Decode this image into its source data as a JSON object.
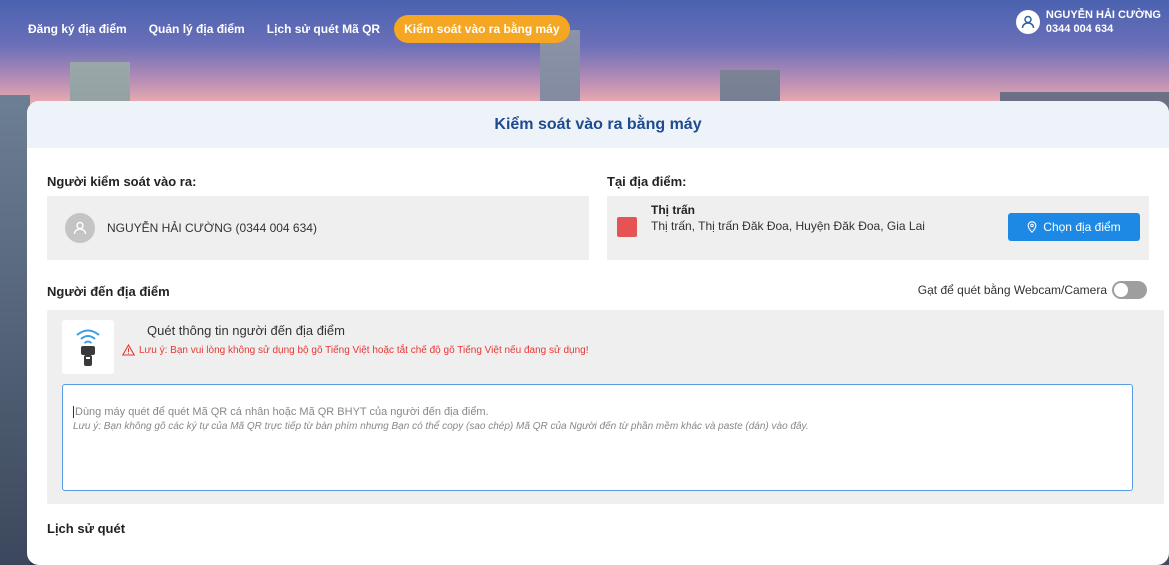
{
  "nav": {
    "items": [
      {
        "label": "Đăng ký địa điểm",
        "active": false
      },
      {
        "label": "Quản lý địa điểm",
        "active": false
      },
      {
        "label": "Lịch sử quét Mã QR",
        "active": false
      },
      {
        "label": "Kiểm soát vào ra bằng máy",
        "active": true
      }
    ]
  },
  "user": {
    "name": "NGUYỄN HẢI CƯỜNG",
    "phone": "0344 004 634",
    "icon": "user-icon"
  },
  "page": {
    "title": "Kiểm soát vào ra bằng máy"
  },
  "controller": {
    "label": "Người kiểm soát vào ra:",
    "name": "NGUYỄN HẢI CƯỜNG (0344 004 634)"
  },
  "location": {
    "label": "Tại địa điểm:",
    "name": "Thị trấn",
    "address": "Thị trấn, Thị trấn Đăk Đoa, Huyện Đăk Đoa, Gia Lai",
    "color": "#e55353",
    "button_label": "Chọn địa điểm"
  },
  "visitor": {
    "label": "Người đến địa điểm",
    "toggle_label": "Gạt để quét bằng Webcam/Camera",
    "toggle_on": false,
    "scan_title": "Quét thông tin người đến địa điểm",
    "warning": "Lưu ý: Bạn vui lòng không sử dụng bộ gõ Tiếng Việt hoặc tắt chế độ gõ Tiếng Việt nếu đang sử dụng!",
    "placeholder": "Dùng máy quét để quét Mã QR cá nhân hoặc Mã QR BHYT của người đến địa điểm.",
    "note": "Lưu ý: Bạn không gõ các ký tự của Mã QR trực tiếp từ bàn phím nhưng Bạn có thể copy (sao chép) Mã QR của Người đến từ phần mềm khác và paste (dán) vào đây."
  },
  "history": {
    "label": "Lịch sử quét"
  },
  "colors": {
    "accent": "#1e88e5",
    "nav_active": "#f5a623",
    "title": "#1d4b8f",
    "warning": "#e53935"
  }
}
